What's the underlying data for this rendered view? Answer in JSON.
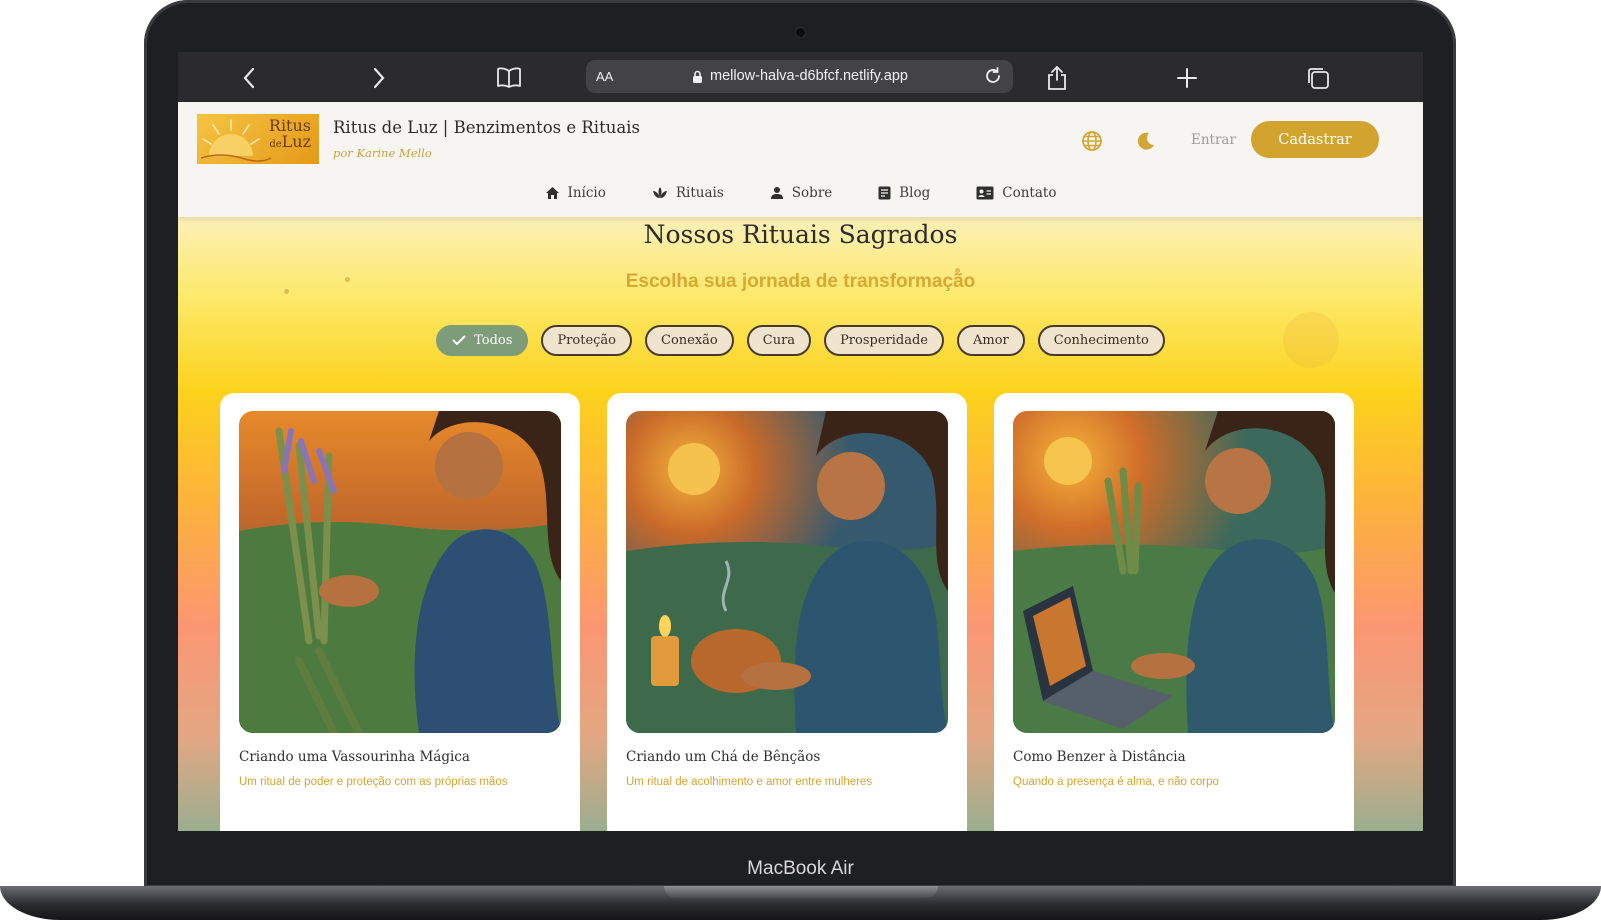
{
  "device": {
    "label": "MacBook Air"
  },
  "browser": {
    "text_size_label": "AA",
    "url": "mellow-halva-d6bfcf.netlify.app",
    "icons": [
      "back-icon",
      "forward-icon",
      "bookmarks-icon",
      "lock-icon",
      "reload-icon",
      "share-icon",
      "new-tab-icon",
      "tabs-icon"
    ]
  },
  "site": {
    "logo": {
      "word1": "Ritus",
      "word2": "de",
      "word3": "Luz"
    },
    "title": "Ritus de Luz | Benzimentos e Rituais",
    "byline": "por Karine Mello",
    "login_label": "Entrar",
    "signup_label": "Cadastrar",
    "accent_color": "#d2a42f",
    "nav": [
      {
        "label": "Início",
        "icon": "home-icon"
      },
      {
        "label": "Rituais",
        "icon": "lotus-icon"
      },
      {
        "label": "Sobre",
        "icon": "person-icon"
      },
      {
        "label": "Blog",
        "icon": "blog-icon"
      },
      {
        "label": "Contato",
        "icon": "contact-card-icon"
      }
    ]
  },
  "main": {
    "title": "Nossos Rituais Sagrados",
    "subtitle": "Escolha sua jornada de transformação",
    "filters": [
      {
        "label": "Todos",
        "active": true
      },
      {
        "label": "Proteção",
        "active": false
      },
      {
        "label": "Conexão",
        "active": false
      },
      {
        "label": "Cura",
        "active": false
      },
      {
        "label": "Prosperidade",
        "active": false
      },
      {
        "label": "Amor",
        "active": false
      },
      {
        "label": "Conhecimento",
        "active": false
      }
    ],
    "cards": [
      {
        "title": "Criando uma Vassourinha Mágica",
        "subtitle": "Um ritual de poder e proteção com as próprias mãos"
      },
      {
        "title": "Criando um Chá de Bênçãos",
        "subtitle": "Um ritual de acolhimento e amor entre mulheres"
      },
      {
        "title": "Como Benzer à Distância",
        "subtitle": "Quando a presença é alma, e não corpo"
      }
    ]
  }
}
